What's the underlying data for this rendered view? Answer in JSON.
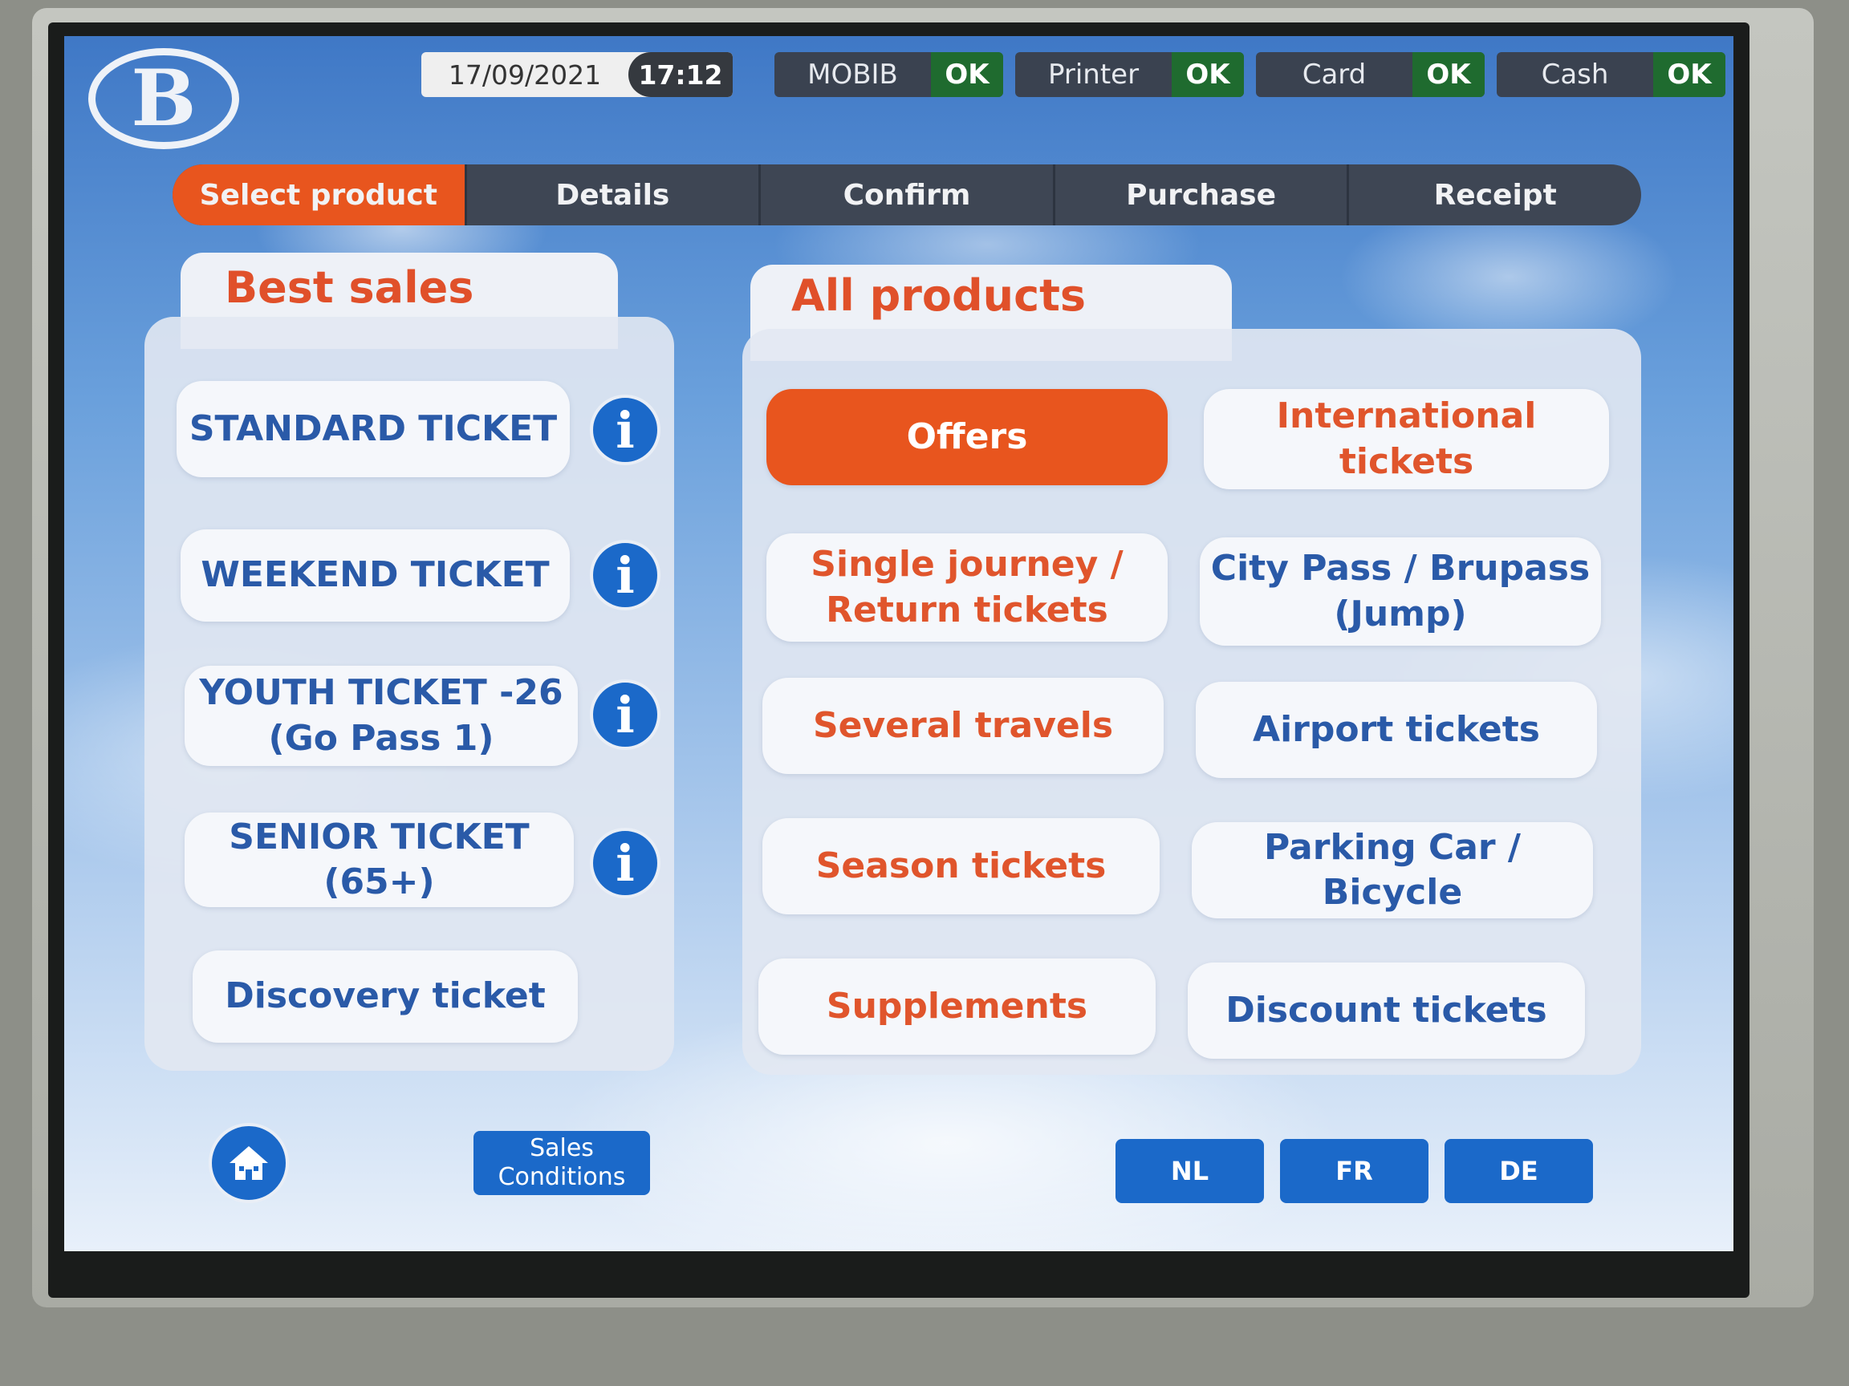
{
  "status": {
    "date": "17/09/2021",
    "time": "17:12",
    "devices": [
      {
        "label": "MOBIB",
        "status": "OK"
      },
      {
        "label": "Printer",
        "status": "OK"
      },
      {
        "label": "Card",
        "status": "OK"
      },
      {
        "label": "Cash",
        "status": "OK"
      }
    ]
  },
  "logo": {
    "letter": "B"
  },
  "steps": [
    "Select product",
    "Details",
    "Confirm",
    "Purchase",
    "Receipt"
  ],
  "best_sales": {
    "title": "Best sales",
    "items": [
      {
        "label": "STANDARD TICKET",
        "info_icon": "i"
      },
      {
        "label": "WEEKEND TICKET",
        "info_icon": "i"
      },
      {
        "label": "YOUTH TICKET -26\n(Go Pass 1)",
        "info_icon": "i"
      },
      {
        "label": "SENIOR TICKET (65+)",
        "info_icon": "i"
      },
      {
        "label": "Discovery ticket"
      }
    ]
  },
  "all_products": {
    "title": "All products",
    "items": [
      {
        "label": "Offers"
      },
      {
        "label": "International tickets"
      },
      {
        "label": "Single journey /\nReturn tickets"
      },
      {
        "label": "City Pass / Brupass\n(Jump)"
      },
      {
        "label": "Several travels"
      },
      {
        "label": "Airport tickets"
      },
      {
        "label": "Season tickets"
      },
      {
        "label": "Parking Car / Bicycle"
      },
      {
        "label": "Supplements"
      },
      {
        "label": "Discount tickets"
      }
    ]
  },
  "footer": {
    "sales_conditions": "Sales\nConditions",
    "languages": [
      "NL",
      "FR",
      "DE"
    ]
  },
  "colors": {
    "accent": "#e8551e",
    "blue": "#1b69c9",
    "text_blue": "#2a5aa8",
    "text_orange": "#e0552c"
  }
}
